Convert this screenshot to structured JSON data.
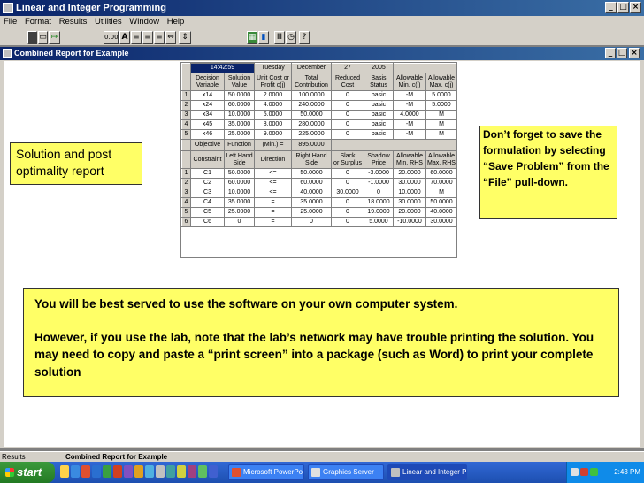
{
  "window": {
    "title": "Linear and Integer Programming"
  },
  "menu": [
    "File",
    "Format",
    "Results",
    "Utilities",
    "Window",
    "Help"
  ],
  "toolbar": {
    "zero_label": "0.00",
    "a_label": "A"
  },
  "child": {
    "title": "Combined Report for Example"
  },
  "report": {
    "header": [
      "14:42:59",
      "Tuesday",
      "December",
      "27",
      "2005"
    ],
    "var_columns": [
      "Decision\nVariable",
      "Solution\nValue",
      "Unit Cost or\nProfit c(j)",
      "Total\nContribution",
      "Reduced\nCost",
      "Basis\nStatus",
      "Allowable\nMin. c(j)",
      "Allowable\nMax. c(j)"
    ],
    "var_rows": [
      {
        "n": "1",
        "cells": [
          "x14",
          "50.0000",
          "2.0000",
          "100.0000",
          "0",
          "basic",
          "-M",
          "5.0000"
        ]
      },
      {
        "n": "2",
        "cells": [
          "x24",
          "60.0000",
          "4.0000",
          "240.0000",
          "0",
          "basic",
          "-M",
          "5.0000"
        ]
      },
      {
        "n": "3",
        "cells": [
          "x34",
          "10.0000",
          "5.0000",
          "50.0000",
          "0",
          "basic",
          "4.0000",
          "M"
        ]
      },
      {
        "n": "4",
        "cells": [
          "x45",
          "35.0000",
          "8.0000",
          "280.0000",
          "0",
          "basic",
          "-M",
          "M"
        ]
      },
      {
        "n": "5",
        "cells": [
          "x46",
          "25.0000",
          "9.0000",
          "225.0000",
          "0",
          "basic",
          "-M",
          "M"
        ]
      }
    ],
    "objective": {
      "label": "Objective",
      "func": "Function",
      "type": "(Min.) =",
      "value": "895.0000"
    },
    "con_columns": [
      "Constraint",
      "Left Hand\nSide",
      "Direction",
      "Right Hand\nSide",
      "Slack\nor Surplus",
      "Shadow\nPrice",
      "Allowable\nMin. RHS",
      "Allowable\nMax. RHS"
    ],
    "con_rows": [
      {
        "n": "1",
        "cells": [
          "C1",
          "50.0000",
          "<=",
          "50.0000",
          "0",
          "-3.0000",
          "20.0000",
          "60.0000"
        ]
      },
      {
        "n": "2",
        "cells": [
          "C2",
          "60.0000",
          "<=",
          "60.0000",
          "0",
          "-1.0000",
          "30.0000",
          "70.0000"
        ]
      },
      {
        "n": "3",
        "cells": [
          "C3",
          "10.0000",
          "<=",
          "40.0000",
          "30.0000",
          "0",
          "10.0000",
          "M"
        ]
      },
      {
        "n": "4",
        "cells": [
          "C4",
          "35.0000",
          "=",
          "35.0000",
          "0",
          "18.0000",
          "30.0000",
          "50.0000"
        ]
      },
      {
        "n": "5",
        "cells": [
          "C5",
          "25.0000",
          "=",
          "25.0000",
          "0",
          "19.0000",
          "20.0000",
          "40.0000"
        ]
      },
      {
        "n": "6",
        "cells": [
          "C6",
          "0",
          "=",
          "0",
          "0",
          "5.0000",
          "-10.0000",
          "30.0000"
        ]
      }
    ]
  },
  "notes": {
    "left": "Solution and post optimality report",
    "right": "Don’t forget to save the formulation by selecting “Save Problem” from the “File” pull-down.",
    "bottom_p1": "You will be best served to use the software on your own computer system.",
    "bottom_p2": "However, if you use the lab, note that the lab’s network may have trouble printing the solution.  You may need to copy and paste a “print screen” into a package (such as Word) to print your complete solution"
  },
  "statusbar": {
    "left": "Results",
    "right": "Combined Report for Example"
  },
  "taskbar": {
    "start": "start",
    "tasks": [
      "Microsoft PowerPoint ...",
      "Graphics Server",
      "Linear and Integer Pr..."
    ],
    "clock": "2:43 PM"
  }
}
